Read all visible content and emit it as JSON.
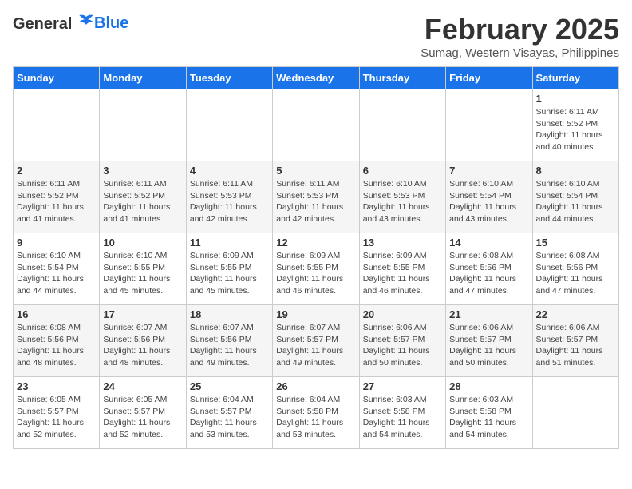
{
  "header": {
    "logo_general": "General",
    "logo_blue": "Blue",
    "month_title": "February 2025",
    "location": "Sumag, Western Visayas, Philippines"
  },
  "weekdays": [
    "Sunday",
    "Monday",
    "Tuesday",
    "Wednesday",
    "Thursday",
    "Friday",
    "Saturday"
  ],
  "weeks": [
    [
      {
        "day": "",
        "info": ""
      },
      {
        "day": "",
        "info": ""
      },
      {
        "day": "",
        "info": ""
      },
      {
        "day": "",
        "info": ""
      },
      {
        "day": "",
        "info": ""
      },
      {
        "day": "",
        "info": ""
      },
      {
        "day": "1",
        "info": "Sunrise: 6:11 AM\nSunset: 5:52 PM\nDaylight: 11 hours and 40 minutes."
      }
    ],
    [
      {
        "day": "2",
        "info": "Sunrise: 6:11 AM\nSunset: 5:52 PM\nDaylight: 11 hours and 41 minutes."
      },
      {
        "day": "3",
        "info": "Sunrise: 6:11 AM\nSunset: 5:52 PM\nDaylight: 11 hours and 41 minutes."
      },
      {
        "day": "4",
        "info": "Sunrise: 6:11 AM\nSunset: 5:53 PM\nDaylight: 11 hours and 42 minutes."
      },
      {
        "day": "5",
        "info": "Sunrise: 6:11 AM\nSunset: 5:53 PM\nDaylight: 11 hours and 42 minutes."
      },
      {
        "day": "6",
        "info": "Sunrise: 6:10 AM\nSunset: 5:53 PM\nDaylight: 11 hours and 43 minutes."
      },
      {
        "day": "7",
        "info": "Sunrise: 6:10 AM\nSunset: 5:54 PM\nDaylight: 11 hours and 43 minutes."
      },
      {
        "day": "8",
        "info": "Sunrise: 6:10 AM\nSunset: 5:54 PM\nDaylight: 11 hours and 44 minutes."
      }
    ],
    [
      {
        "day": "9",
        "info": "Sunrise: 6:10 AM\nSunset: 5:54 PM\nDaylight: 11 hours and 44 minutes."
      },
      {
        "day": "10",
        "info": "Sunrise: 6:10 AM\nSunset: 5:55 PM\nDaylight: 11 hours and 45 minutes."
      },
      {
        "day": "11",
        "info": "Sunrise: 6:09 AM\nSunset: 5:55 PM\nDaylight: 11 hours and 45 minutes."
      },
      {
        "day": "12",
        "info": "Sunrise: 6:09 AM\nSunset: 5:55 PM\nDaylight: 11 hours and 46 minutes."
      },
      {
        "day": "13",
        "info": "Sunrise: 6:09 AM\nSunset: 5:55 PM\nDaylight: 11 hours and 46 minutes."
      },
      {
        "day": "14",
        "info": "Sunrise: 6:08 AM\nSunset: 5:56 PM\nDaylight: 11 hours and 47 minutes."
      },
      {
        "day": "15",
        "info": "Sunrise: 6:08 AM\nSunset: 5:56 PM\nDaylight: 11 hours and 47 minutes."
      }
    ],
    [
      {
        "day": "16",
        "info": "Sunrise: 6:08 AM\nSunset: 5:56 PM\nDaylight: 11 hours and 48 minutes."
      },
      {
        "day": "17",
        "info": "Sunrise: 6:07 AM\nSunset: 5:56 PM\nDaylight: 11 hours and 48 minutes."
      },
      {
        "day": "18",
        "info": "Sunrise: 6:07 AM\nSunset: 5:56 PM\nDaylight: 11 hours and 49 minutes."
      },
      {
        "day": "19",
        "info": "Sunrise: 6:07 AM\nSunset: 5:57 PM\nDaylight: 11 hours and 49 minutes."
      },
      {
        "day": "20",
        "info": "Sunrise: 6:06 AM\nSunset: 5:57 PM\nDaylight: 11 hours and 50 minutes."
      },
      {
        "day": "21",
        "info": "Sunrise: 6:06 AM\nSunset: 5:57 PM\nDaylight: 11 hours and 50 minutes."
      },
      {
        "day": "22",
        "info": "Sunrise: 6:06 AM\nSunset: 5:57 PM\nDaylight: 11 hours and 51 minutes."
      }
    ],
    [
      {
        "day": "23",
        "info": "Sunrise: 6:05 AM\nSunset: 5:57 PM\nDaylight: 11 hours and 52 minutes."
      },
      {
        "day": "24",
        "info": "Sunrise: 6:05 AM\nSunset: 5:57 PM\nDaylight: 11 hours and 52 minutes."
      },
      {
        "day": "25",
        "info": "Sunrise: 6:04 AM\nSunset: 5:57 PM\nDaylight: 11 hours and 53 minutes."
      },
      {
        "day": "26",
        "info": "Sunrise: 6:04 AM\nSunset: 5:58 PM\nDaylight: 11 hours and 53 minutes."
      },
      {
        "day": "27",
        "info": "Sunrise: 6:03 AM\nSunset: 5:58 PM\nDaylight: 11 hours and 54 minutes."
      },
      {
        "day": "28",
        "info": "Sunrise: 6:03 AM\nSunset: 5:58 PM\nDaylight: 11 hours and 54 minutes."
      },
      {
        "day": "",
        "info": ""
      }
    ]
  ]
}
